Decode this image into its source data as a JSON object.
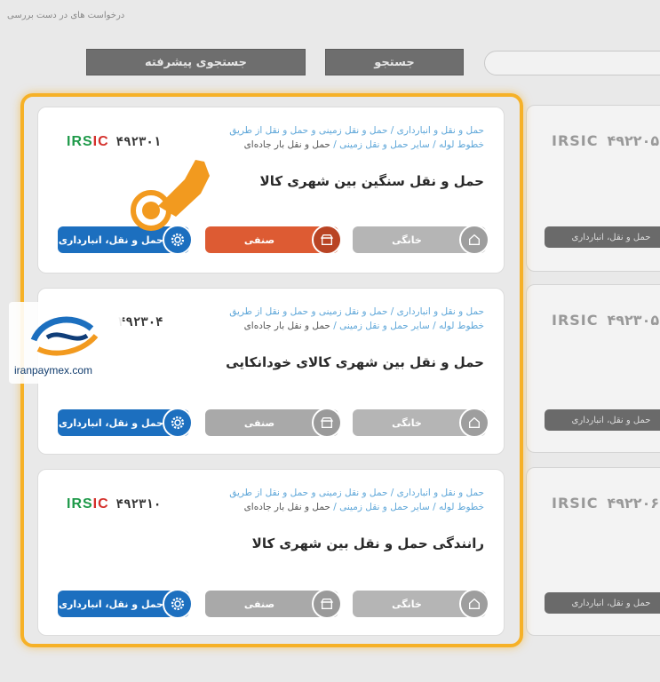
{
  "header": {
    "hint": "درخواست های در دست بررسی",
    "advanced_search": "جستجوی پیشرفته",
    "search": "جستجو"
  },
  "cards": [
    {
      "crumbs": "حمل و نقل و انبارداری / حمل و نقل زمینی و حمل و نقل از طریق خطوط لوله / سایر حمل و نقل زمینی /",
      "crumb_last": "حمل و نقل بار جاده‌ای",
      "irsic_g": "IRS",
      "irsic_r": "IC",
      "code": "۴۹۲۳۰۱",
      "title": "حمل و نقل سنگین بین شهری کالا",
      "anbar": "حمل و نقل، انبارداری",
      "senfi": "صنفی",
      "khanegi": "خانگی"
    },
    {
      "crumbs": "حمل و نقل و انبارداری / حمل و نقل زمینی و حمل و نقل از طریق خطوط لوله / سایر حمل و نقل زمینی /",
      "crumb_last": "حمل و نقل بار جاده‌ای",
      "code": "۴۹۲۳۰۴",
      "title": "حمل و نقل بین شهری کالای خودانکایی",
      "anbar": "حمل و نقل، انبارداری",
      "senfi": "صنفی",
      "khanegi": "خانگی"
    },
    {
      "crumbs": "حمل و نقل و انبارداری / حمل و نقل زمینی و حمل و نقل از طریق خطوط لوله / سایر حمل و نقل زمینی /",
      "crumb_last": "حمل و نقل بار جاده‌ای",
      "irsic_g": "IRS",
      "irsic_r": "IC",
      "code": "۴۹۲۳۱۰",
      "title": "رانندگی حمل و نقل بین شهری کالا",
      "anbar": "حمل و نقل، انبارداری",
      "senfi": "صنفی",
      "khanegi": "خانگی"
    }
  ],
  "side_cards": [
    {
      "irsic": "IRSIC",
      "code": "۴۹۲۲۰۵",
      "label": "حمل و نقل، انبارداری"
    },
    {
      "irsic": "IRSIC",
      "code": "۴۹۲۳۰۵",
      "label": "حمل و نقل، انبارداری"
    },
    {
      "irsic": "IRSIC",
      "code": "۴۹۲۲۰۶",
      "label": "حمل و نقل، انبارداری"
    }
  ],
  "watermark": {
    "url": "iranpaymex.com"
  },
  "colors": {
    "frame": "#f6b127",
    "active": "#dd5b33",
    "primary": "#1c6fbf"
  }
}
